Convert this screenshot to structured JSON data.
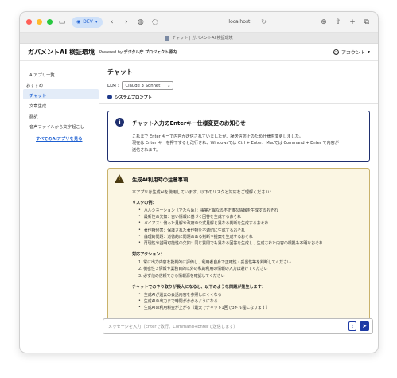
{
  "browser": {
    "dev_badge": "DEV",
    "url": "localhost",
    "tab_title": "チャット | ガバメントAI 検証環境"
  },
  "header": {
    "app_title": "ガバメントAI 検証環境",
    "powered_prefix": "Powered by",
    "powered_org": "デジタル庁 プロジェクト源内",
    "account_label": "アカウント"
  },
  "sidebar": {
    "items": [
      {
        "label": "AIアプリ一覧",
        "kind": "item"
      },
      {
        "label": "おすすめ",
        "kind": "heading"
      },
      {
        "label": "チャット",
        "kind": "active"
      },
      {
        "label": "文章生成",
        "kind": "item"
      },
      {
        "label": "翻訳",
        "kind": "item"
      },
      {
        "label": "音声ファイルから文字起こし",
        "kind": "item"
      }
    ],
    "all_apps_link": "すべてのAIアプリを見る"
  },
  "main": {
    "page_title": "チャット",
    "llm_label": "LLM :",
    "llm_value": "Claude 3 Sonnet",
    "system_prompt_label": "システムプロンプト"
  },
  "info": {
    "title": "チャット入力のEnterキー仕様変更のお知らせ",
    "line1": "これまで Enter キーで内容が送信されていましたが、誤送信防止のため仕様を変更しました。",
    "line2": "現在は Enter キーを押下すると改行され、Windowsでは Ctrl + Enter、Macでは Command + Enter で内容が",
    "line3": "送信されます。"
  },
  "warning": {
    "title": "生成AI利用時の注意事項",
    "intro": "本アプリは生成AIを使用しています。以下のリスクと対応をご理解ください：",
    "risk_heading": "リスクの例：",
    "risks": [
      "ハルシネーション（でたらめ）：事実と異なる不正確な情報を生成するおそれ",
      "最新性の欠如：古い情報に基づく回答を生成するおそれ",
      "バイアス：偏った見解や政府の公式見解と異なる判断を生成するおそれ",
      "著作権侵害：保護された著作物を不適切に生成するおそれ",
      "倫理的問題：道徳的に問題のある判断や提案を生成するおそれ",
      "再現性や説明可能性の欠如：同じ質問でも異なる回答を生成し、生成された内容の根拠も不明なおそれ"
    ],
    "action_heading": "対応アクション：",
    "actions": [
      "1. 常に出力内容を批判的に評価し、利用者自身で正確性・妥当性等を判断してください",
      "2. 機密性３情報や業務目的以外の私的利用の情報の入力は避けてください",
      "3. 必ず他の信頼できる情報源を確認してください"
    ],
    "long_heading": "チャットでのやり取りが長大になると、以下のような問題が発生します：",
    "long_issues": [
      "生成AIが過去の会話内容を参照しにくくなる",
      "生成AIの出力まで時間がかかるようになる",
      "生成AIの利用料金が上がる（最大でチャット1回で3ドル程になります）"
    ]
  },
  "input": {
    "placeholder": "メッセージを入力（Enterで改行、Command+Enterで送信します）"
  }
}
